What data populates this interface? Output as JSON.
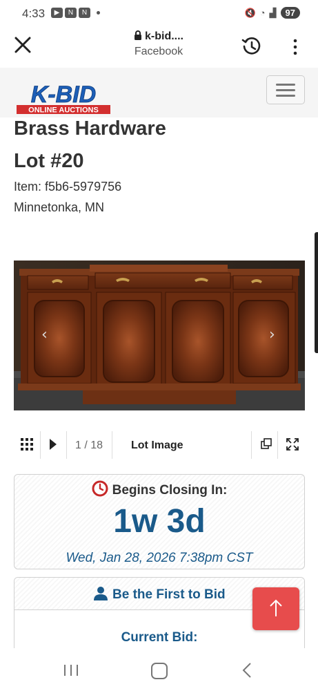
{
  "status_bar": {
    "time": "4:33",
    "battery": "97"
  },
  "browser": {
    "url": "k-bid....",
    "source": "Facebook"
  },
  "site": {
    "logo_text": "K-BID",
    "logo_subtext": "ONLINE AUCTIONS"
  },
  "lot": {
    "title": "Brass Hardware",
    "number": "Lot #20",
    "item": "Item: f5b6-5979756",
    "location": "Minnetonka, MN"
  },
  "image_toolbar": {
    "counter": "1 / 18",
    "label": "Lot Image"
  },
  "closing": {
    "label": "Begins Closing In:",
    "countdown": "1w 3d",
    "date": "Wed, Jan 28, 2026 7:38pm CST"
  },
  "bidding": {
    "first_bid_label": "Be the First to Bid",
    "current_bid_label": "Current Bid:"
  },
  "colors": {
    "accent_blue": "#1a5a8a",
    "logo_red": "#d32f2f",
    "logo_blue": "#1d5fb8",
    "scroll_top": "#e74c4c"
  }
}
